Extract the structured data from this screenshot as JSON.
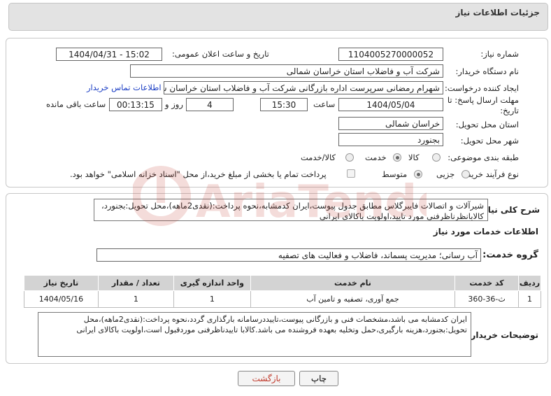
{
  "header": {
    "title": "جزئیات اطلاعات نیاز"
  },
  "form": {
    "need_number_label": "شماره نیاز:",
    "need_number": "1104005270000052",
    "announce_label": "تاریخ و ساعت اعلان عمومی:",
    "announce_value": "1404/04/31 - 15:02",
    "buyer_label": "نام دستگاه خریدار:",
    "buyer_value": "شرکت آب و فاضلاب استان خراسان شمالی",
    "creator_label": "ایجاد کننده درخواست:",
    "creator_value": "شهرام رمضانی سرپرست اداره بازرگانی  شرکت آب و فاضلاب استان خراسان شمالی",
    "contact_link": "اطلاعات تماس خریدار",
    "deadline_label": "مهلت ارسال پاسخ: تا تاریخ:",
    "deadline_date": "1404/05/04",
    "time_label": "ساعت",
    "deadline_time": "15:30",
    "days_value": "4",
    "days_label": "روز و",
    "remaining_time": "00:13:15",
    "remaining_label": "ساعت باقی مانده",
    "province_label": "استان محل تحویل:",
    "province_value": "خراسان شمالی",
    "city_label": "شهر محل تحویل:",
    "city_value": "بجنورد",
    "category_label": "طبقه بندی موضوعی:",
    "category_options": [
      "کالا",
      "خدمت",
      "کالا/خدمت"
    ],
    "category_selected": "خدمت",
    "process_label": "نوع فرآیند خرید :",
    "process_options": [
      "جزیی",
      "متوسط"
    ],
    "process_selected": "متوسط",
    "treasury_text": "پرداخت تمام یا بخشی از مبلغ خرید،از محل \"اسناد خزانه اسلامی\" خواهد بود."
  },
  "summary": {
    "label": "شرح کلی نیاز:",
    "text": "شیرآلات و اتصالات فایبرگلاس مطابق جدول پیوست،ایران کدمشابه،نحوه پرداخت:(نقدی2ماهه)،محل تحویل:بجنورد، کالابانظرناظرفنی مورد تایید،اولویت باکالای ایرانی"
  },
  "services": {
    "section_title": "اطلاعات خدمات مورد نیاز",
    "group_label": "گروه خدمت:",
    "group_value": "آب رسانی؛ مدیریت پسماند، فاضلاب و فعالیت های تصفیه",
    "columns": [
      "ردیف",
      "کد خدمت",
      "نام خدمت",
      "واحد اندازه گیری",
      "تعداد / مقدار",
      "تاریخ نیاز"
    ],
    "rows": [
      {
        "row": "1",
        "code": "ث-36-360",
        "name": "جمع آوری، تصفیه و تامین آب",
        "unit": "1",
        "qty": "1",
        "date": "1404/05/16"
      }
    ]
  },
  "buyer_notes": {
    "label": "توضیحات خریدار:",
    "text": "ایران کدمشابه می باشد،مشخصات فنی و بازرگانی پیوست،تاییددرسامانه بارگذاری گردد،نحوه پرداخت:(نقدی2ماهه)،محل تحویل:بجنورد،هزینه بارگیری،حمل وتخلیه بعهده فروشنده می باشد.کالابا تاییدناظرفنی موردقبول است،اولویت باکالای ایرانی"
  },
  "buttons": {
    "print": "چاپ",
    "back": "بازگشت"
  },
  "watermark": {
    "text": "AriaTender.neT"
  },
  "colors": {
    "link": "#1b3ec4",
    "back_text": "#c0392b",
    "watermark": "#c0392b"
  }
}
